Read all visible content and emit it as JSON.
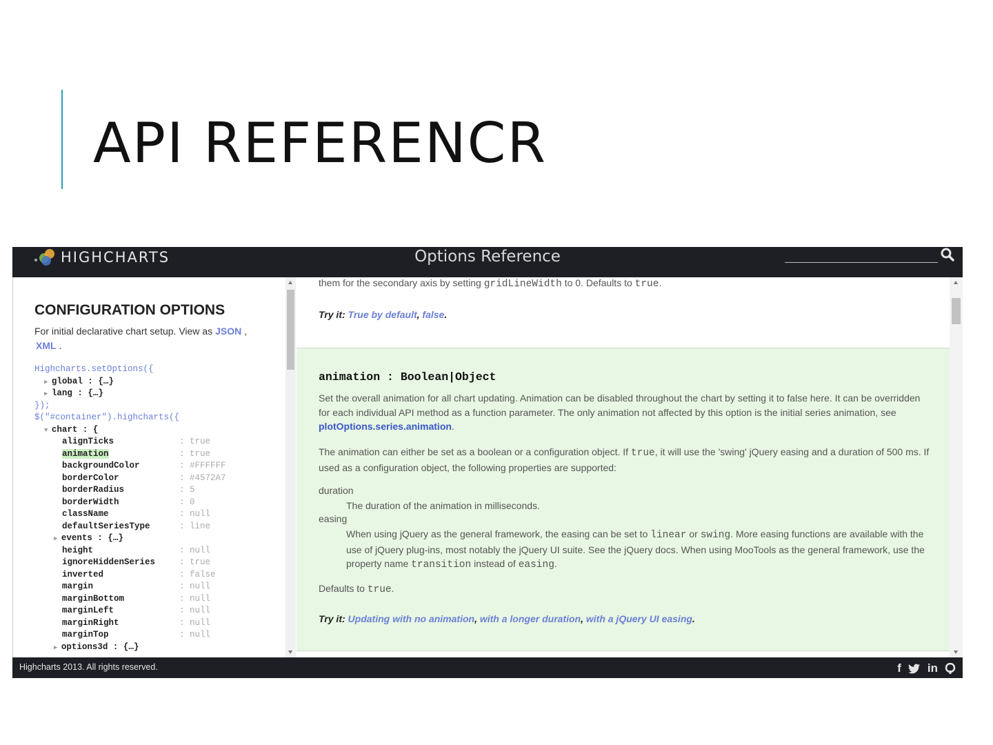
{
  "slide": {
    "title": "API REFERENCR"
  },
  "topbar": {
    "logo_text": "HIGHCHARTS",
    "title": "Options Reference",
    "search_placeholder": ""
  },
  "left": {
    "heading": "CONFIGURATION OPTIONS",
    "desc": "For initial declarative chart setup. View as",
    "json_link": "JSON",
    "comma": ",",
    "xml_link": "XML",
    "period": ".",
    "tree_rows": [
      {
        "text": "Highcharts.setOptions({",
        "type": "blue",
        "indent": 0
      },
      {
        "text": "global : {…}",
        "type": "collapsed",
        "indent": 1
      },
      {
        "text": "lang : {…}",
        "type": "collapsed",
        "indent": 1
      },
      {
        "text": "});",
        "type": "blue",
        "indent": 0
      },
      {
        "text": "$(\"#container\").highcharts({",
        "type": "blue",
        "indent": 0
      },
      {
        "text": "chart : {",
        "type": "expanded",
        "indent": 1
      },
      {
        "key": "alignTicks",
        "value": ": true",
        "indent": 2
      },
      {
        "key": "animation",
        "value": ": true",
        "indent": 2,
        "highlight": true
      },
      {
        "key": "backgroundColor",
        "value": ": #FFFFFF",
        "indent": 2
      },
      {
        "key": "borderColor",
        "value": ": #4572A7",
        "indent": 2
      },
      {
        "key": "borderRadius",
        "value": ": 5",
        "indent": 2
      },
      {
        "key": "borderWidth",
        "value": ": 0",
        "indent": 2
      },
      {
        "key": "className",
        "value": ": null",
        "indent": 2
      },
      {
        "key": "defaultSeriesType",
        "value": ": line",
        "indent": 2
      },
      {
        "text": "events : {…}",
        "type": "collapsed",
        "indent": 2
      },
      {
        "key": "height",
        "value": ": null",
        "indent": 2
      },
      {
        "key": "ignoreHiddenSeries",
        "value": ": true",
        "indent": 2
      },
      {
        "key": "inverted",
        "value": ": false",
        "indent": 2
      },
      {
        "key": "margin",
        "value": ": null",
        "indent": 2
      },
      {
        "key": "marginBottom",
        "value": ": null",
        "indent": 2
      },
      {
        "key": "marginLeft",
        "value": ": null",
        "indent": 2
      },
      {
        "key": "marginRight",
        "value": ": null",
        "indent": 2
      },
      {
        "key": "marginTop",
        "value": ": null",
        "indent": 2
      },
      {
        "text": "options3d : {…}",
        "type": "collapsed",
        "indent": 2
      }
    ]
  },
  "right": {
    "top_line_a": "them for the secondary axis by setting ",
    "top_line_code": "gridLineWidth",
    "top_line_b": " to 0. Defaults to ",
    "top_line_code2": "true",
    "top_line_c": ".",
    "try1_label": "Try it:",
    "try1_link1": "True by default",
    "try1_sep": ",",
    "try1_link2": "false",
    "try1_end": ".",
    "opt_name": "animation : Boolean|Object",
    "p1_a": "Set the overall animation for all chart updating. Animation can be disabled throughout the chart by setting it to false here. It can be overridden for each individual API method as a function parameter. The only animation not affected by this option is the initial series animation, see ",
    "p1_link": "plotOptions.series.animation",
    "p1_b": ".",
    "p2_a": "The animation can either be set as a boolean or a configuration object. If ",
    "p2_code": "true",
    "p2_b": ", it will use the 'swing' jQuery easing and a duration of 500 ms. If used as a configuration object, the following properties are supported:",
    "term1": "duration",
    "def1": "The duration of the animation in milliseconds.",
    "term2": "easing",
    "def2_a": "When using jQuery as the general framework, the easing can be set to ",
    "def2_code1": "linear",
    "def2_b": " or ",
    "def2_code2": "swing",
    "def2_c": ". More easing functions are available with the use of jQuery plug-ins, most notably the jQuery UI suite. See ",
    "def2_link": "the jQuery docs",
    "def2_d": ". When using MooTools as the general framework, use the property name ",
    "def2_code3": "transition",
    "def2_e": " instead of ",
    "def2_code4": "easing",
    "def2_f": ".",
    "defaults_a": "Defaults to ",
    "defaults_code": "true",
    "defaults_b": ".",
    "try2_label": "Try it:",
    "try2_link1": "Updating with no animation",
    "try2_sep1": ",",
    "try2_link2": "with a longer duration",
    "try2_sep2": ",",
    "try2_link3": "with a jQuery UI easing",
    "try2_end": "."
  },
  "footer": {
    "text": "Highcharts 2013. All rights reserved.",
    "social": [
      "f",
      "t",
      "in",
      "gh"
    ]
  },
  "colors": {
    "accent": "#2aa0b4",
    "link": "#6b7fd6",
    "bar": "#1d1f25",
    "green_bg": "#e8f7e3"
  }
}
